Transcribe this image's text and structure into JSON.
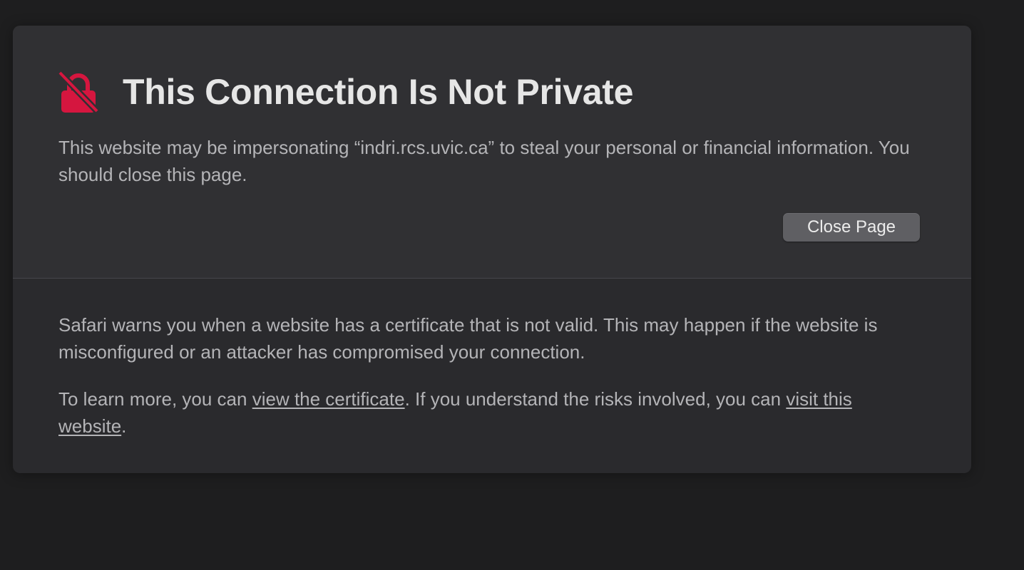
{
  "header": {
    "title": "This Connection Is Not Private",
    "icon": "broken-lock-icon",
    "icon_color": "#d5163f"
  },
  "warning": {
    "text": "This website may be impersonating “indri.rcs.uvic.ca” to steal your personal or financial information. You should close this page."
  },
  "actions": {
    "close_label": "Close Page"
  },
  "details": {
    "explanation": "Safari warns you when a website has a certificate that is not valid. This may happen if the website is misconfigured or an attacker has compromised your connection.",
    "learn_more_prefix": "To learn more, you can ",
    "view_certificate_link": "view the certificate",
    "learn_more_middle": ". If you understand the risks involved, you can ",
    "visit_website_link": "visit this website",
    "learn_more_suffix": "."
  },
  "colors": {
    "page_background": "#1e1e1f",
    "card_top": "#303033",
    "card_bottom": "#2a2a2d",
    "button": "#5f5f63",
    "text": "#b4b4b7",
    "title": "#e6e6e6"
  }
}
